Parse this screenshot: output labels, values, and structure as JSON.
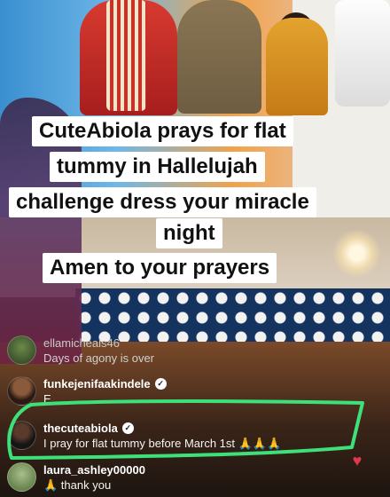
{
  "caption": {
    "line1": "CuteAbiola prays for flat",
    "line2": "tummy in Hallelujah",
    "line3": "challenge dress your miracle",
    "line4": "night",
    "line5": "Amen to your prayers"
  },
  "comments": [
    {
      "username": "ellamicheals46",
      "text": "Days of agony is over",
      "verified": false
    },
    {
      "username": "funkejenifaakindele",
      "text": "E",
      "verified": true
    },
    {
      "username": "thecuteabiola",
      "text": "I pray for flat tummy before March 1st 🙏🙏🙏",
      "verified": true
    },
    {
      "username": "laura_ashley00000",
      "text": "🙏 thank you",
      "verified": false
    }
  ],
  "colors": {
    "highlight": "#3ee07a",
    "caption_bg": "#ffffff",
    "caption_text": "#111111"
  },
  "icons": {
    "verified": "verified-badge-icon",
    "heart": "heart-icon"
  }
}
